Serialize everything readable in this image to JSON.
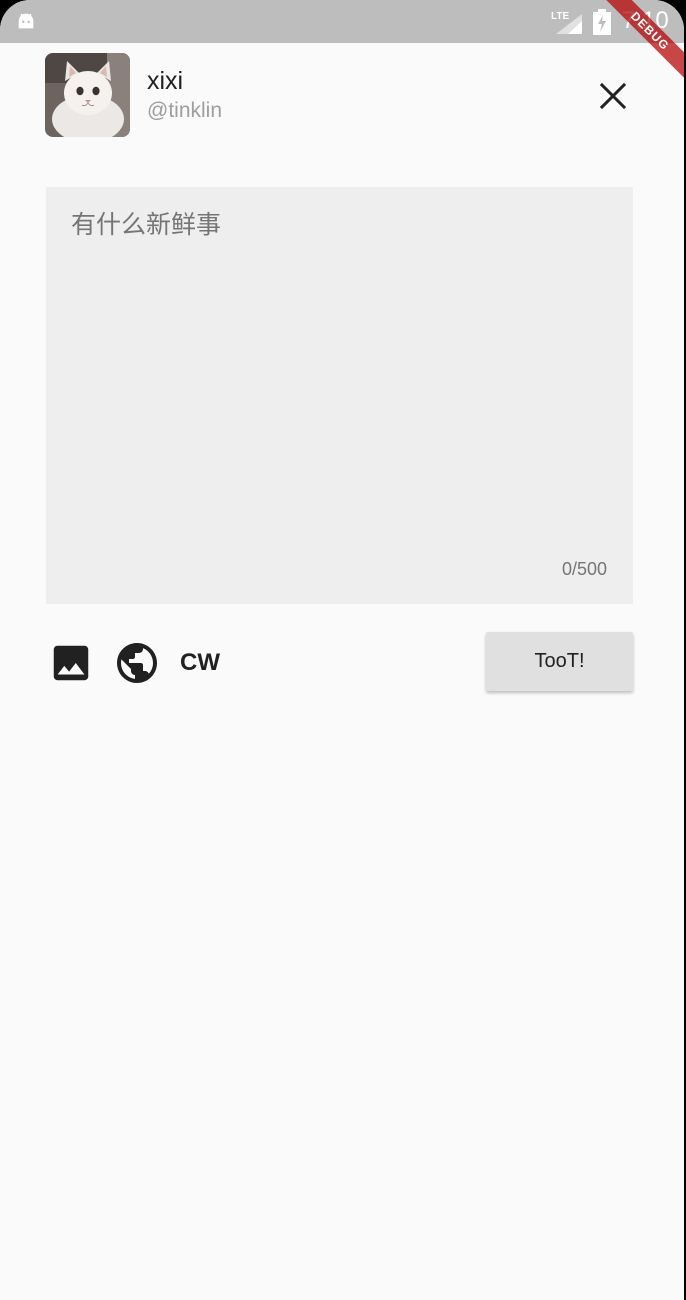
{
  "status_bar": {
    "network": "LTE",
    "time": "7:10",
    "icons": [
      "android-icon",
      "signal-icon",
      "battery-charging-icon"
    ]
  },
  "debug_banner": "DEBUG",
  "account": {
    "display_name": "xixi",
    "username": "@tinklin",
    "avatar": "cat-avatar"
  },
  "compose": {
    "placeholder": "有什么新鲜事",
    "value": "",
    "counter": "0/500"
  },
  "toolbar": {
    "image_icon": "image-icon",
    "visibility_icon": "globe-icon",
    "cw_label": "CW",
    "toot_label": "TooT!"
  },
  "colors": {
    "status_bar": "#bdbdbd",
    "background": "#fafafa",
    "compose_box": "#eeeeee",
    "button": "#e0e0e0",
    "text": "#212121",
    "secondary_text": "#9e9e9e"
  }
}
